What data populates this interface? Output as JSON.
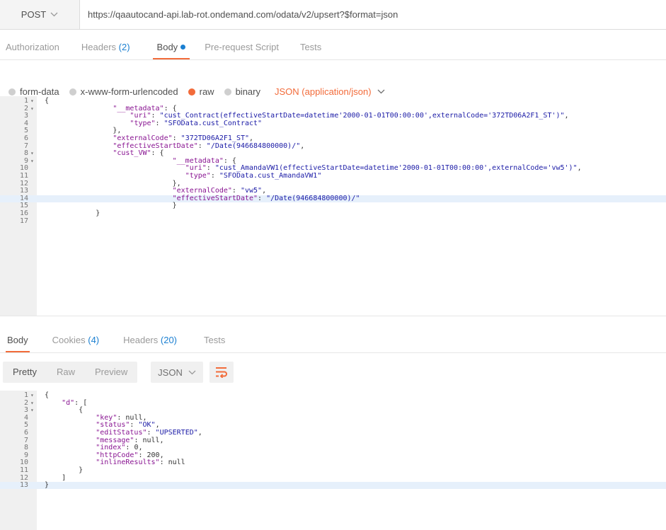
{
  "request": {
    "method": "POST",
    "url": "https://qaautocand-api.lab-rot.ondemand.com/odata/v2/upsert?$format=json"
  },
  "request_tabs": [
    {
      "label": "Authorization",
      "count": ""
    },
    {
      "label": "Headers",
      "count": "(2)"
    },
    {
      "label": "Body",
      "count": ""
    },
    {
      "label": "Pre-request Script",
      "count": ""
    },
    {
      "label": "Tests",
      "count": ""
    }
  ],
  "body_options": {
    "form_data": "form-data",
    "urlencoded": "x-www-form-urlencoded",
    "raw": "raw",
    "binary": "binary",
    "content_type": "JSON (application/json)"
  },
  "request_lines": [
    {
      "n": "1",
      "fold": "▾",
      "code": "{"
    },
    {
      "n": "2",
      "fold": "▾",
      "code": "                \"__metadata\": {"
    },
    {
      "n": "3",
      "fold": "",
      "code": "                    \"uri\": \"cust_Contract(effectiveStartDate=datetime'2000-01-01T00:00:00',externalCode='372TD06A2F1_ST')\","
    },
    {
      "n": "4",
      "fold": "",
      "code": "                    \"type\": \"SFOData.cust_Contract\""
    },
    {
      "n": "5",
      "fold": "",
      "code": "                },"
    },
    {
      "n": "6",
      "fold": "",
      "code": "                \"externalCode\": \"372TD06A2F1_ST\","
    },
    {
      "n": "7",
      "fold": "",
      "code": "                \"effectiveStartDate\": \"/Date(946684800000)/\","
    },
    {
      "n": "8",
      "fold": "▾",
      "code": "                \"cust_VW\": {"
    },
    {
      "n": "9",
      "fold": "▾",
      "code": "                              \"__metadata\": {"
    },
    {
      "n": "10",
      "fold": "",
      "code": "                                 \"uri\": \"cust_AmandaVW1(effectiveStartDate=datetime'2000-01-01T00:00:00',externalCode='vw5')\","
    },
    {
      "n": "11",
      "fold": "",
      "code": "                                 \"type\": \"SFOData.cust_AmandaVW1\""
    },
    {
      "n": "12",
      "fold": "",
      "code": "                              },"
    },
    {
      "n": "13",
      "fold": "",
      "code": "                              \"externalCode\": \"vw5\","
    },
    {
      "n": "14",
      "fold": "",
      "code": "                              \"effectiveStartDate\": \"/Date(946684800000)/\""
    },
    {
      "n": "15",
      "fold": "",
      "code": "                              }"
    },
    {
      "n": "16",
      "fold": "",
      "code": "            }"
    },
    {
      "n": "17",
      "fold": "",
      "code": ""
    }
  ],
  "response_tabs": [
    {
      "label": "Body",
      "count": ""
    },
    {
      "label": "Cookies",
      "count": "(4)"
    },
    {
      "label": "Headers",
      "count": "(20)"
    },
    {
      "label": "Tests",
      "count": ""
    }
  ],
  "response_view": {
    "pretty": "Pretty",
    "raw": "Raw",
    "preview": "Preview",
    "format": "JSON"
  },
  "response_lines": [
    {
      "n": "1",
      "fold": "▾",
      "code": "{"
    },
    {
      "n": "2",
      "fold": "▾",
      "code": "    \"d\": ["
    },
    {
      "n": "3",
      "fold": "▾",
      "code": "        {"
    },
    {
      "n": "4",
      "fold": "",
      "code": "            \"key\": null,"
    },
    {
      "n": "5",
      "fold": "",
      "code": "            \"status\": \"OK\","
    },
    {
      "n": "6",
      "fold": "",
      "code": "            \"editStatus\": \"UPSERTED\","
    },
    {
      "n": "7",
      "fold": "",
      "code": "            \"message\": null,"
    },
    {
      "n": "8",
      "fold": "",
      "code": "            \"index\": 0,"
    },
    {
      "n": "9",
      "fold": "",
      "code": "            \"httpCode\": 200,"
    },
    {
      "n": "10",
      "fold": "",
      "code": "            \"inlineResults\": null"
    },
    {
      "n": "11",
      "fold": "",
      "code": "        }"
    },
    {
      "n": "12",
      "fold": "",
      "code": "    ]"
    },
    {
      "n": "13",
      "fold": "",
      "code": "}"
    }
  ],
  "colors": {
    "accent": "#f26b3a",
    "link": "#1a7fd1"
  }
}
